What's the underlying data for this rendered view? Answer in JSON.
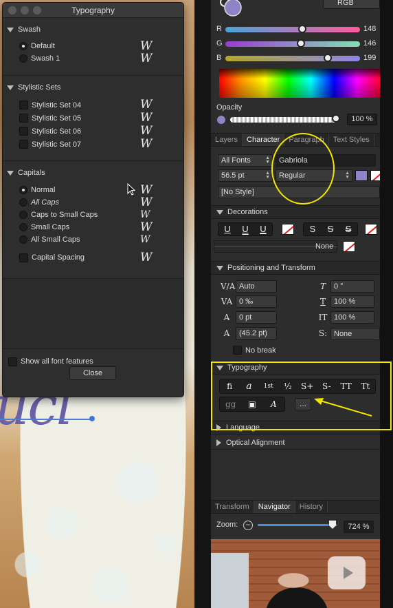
{
  "typography_panel": {
    "title": "Typography",
    "sections": {
      "swash": {
        "title": "Swash",
        "options": [
          "Default",
          "Swash 1"
        ],
        "selected": "Default"
      },
      "stylistic_sets": {
        "title": "Stylistic Sets",
        "options": [
          "Stylistic Set 04",
          "Stylistic Set 05",
          "Stylistic Set 06",
          "Stylistic Set 07"
        ]
      },
      "capitals": {
        "title": "Capitals",
        "options": [
          "Normal",
          "All Caps",
          "Caps to Small Caps",
          "Small Caps",
          "All Small Caps"
        ],
        "selected": "Normal",
        "spacing_label": "Capital Spacing"
      }
    },
    "sample_glyph": "W",
    "show_all_label": "Show all font features",
    "close_label": "Close"
  },
  "color": {
    "mode": "RGB",
    "sliders": [
      {
        "label": "R",
        "value": "148"
      },
      {
        "label": "G",
        "value": "146"
      },
      {
        "label": "B",
        "value": "199"
      }
    ],
    "swatch_color": "#8d84c6",
    "opacity_label": "Opacity",
    "opacity_value": "100 %"
  },
  "tabs": [
    "Layers",
    "Character",
    "Paragraph",
    "Text Styles"
  ],
  "character": {
    "font_collection": "All Fonts",
    "font_family": "Gabriola",
    "font_size": "56.5 pt",
    "font_style": "Regular",
    "text_style": "[No Style]"
  },
  "decorations": {
    "title": "Decorations",
    "underline_buttons": [
      "U",
      "U",
      "U"
    ],
    "strike_buttons": [
      "S",
      "S",
      "S"
    ],
    "none_label": "None"
  },
  "positioning": {
    "title": "Positioning and Transform",
    "tracking": "Auto",
    "kerning": "0 ‰",
    "baseline": "0 pt",
    "leading": "(45.2 pt)",
    "shear": "0 °",
    "vertical_scale": "100 %",
    "horizontal_scale": "100 %",
    "position": "None",
    "no_break_label": "No break"
  },
  "typography_section": {
    "title": "Typography",
    "row1": [
      "fi",
      "a",
      "1st",
      "½",
      "S+",
      "S-",
      "TT",
      "Tt"
    ],
    "row2": [
      "gg",
      "▣",
      "A"
    ],
    "more_label": "..."
  },
  "language": {
    "title": "Language"
  },
  "optical_alignment": {
    "title": "Optical Alignment"
  },
  "navigator": {
    "tabs": [
      "Transform",
      "Navigator",
      "History"
    ],
    "zoom_label": "Zoom:",
    "zoom_value": "724 %"
  },
  "canvas_text": "ucl"
}
